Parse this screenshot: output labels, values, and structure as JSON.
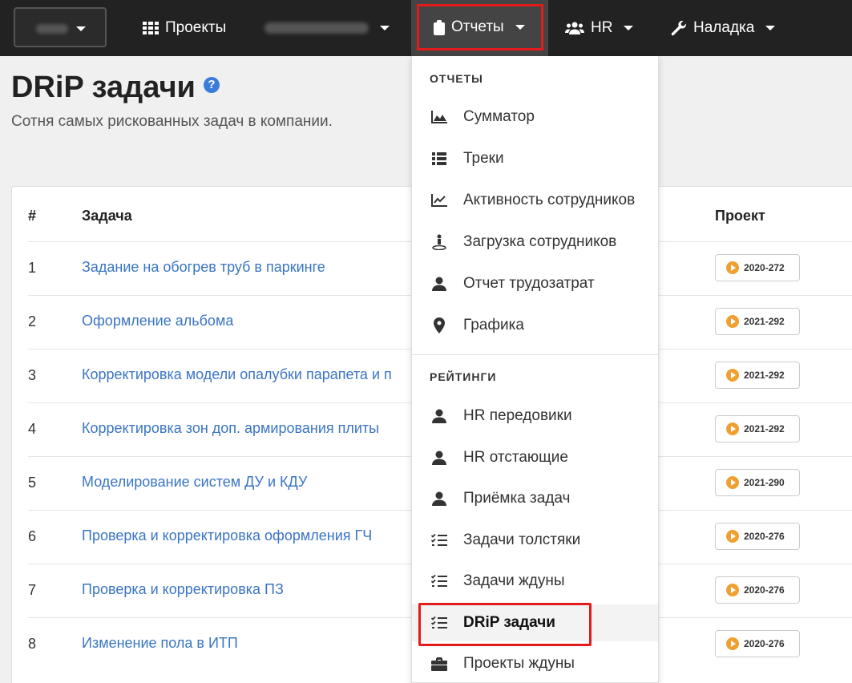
{
  "navbar": {
    "workspace_caret": "chevron-down-icon",
    "items": [
      {
        "label": "Проекты",
        "icon": "grid-icon"
      },
      {
        "label": "",
        "icon": ""
      },
      {
        "label": "Отчеты",
        "icon": "clipboard-icon"
      },
      {
        "label": "HR",
        "icon": "users-icon"
      },
      {
        "label": "Наладка",
        "icon": "wrench-icon"
      }
    ]
  },
  "page": {
    "title": "DRiP задачи",
    "help_icon": "question-circle-icon",
    "subtitle": "Сотня самых рискованных задач в компании."
  },
  "table": {
    "columns": [
      "#",
      "Задача",
      "Проект"
    ],
    "rows": [
      {
        "num": "1",
        "task": "Задание на обогрев труб в паркинге",
        "project": "2020-272"
      },
      {
        "num": "2",
        "task": "Оформление альбома",
        "project": "2021-292"
      },
      {
        "num": "3",
        "task": "Корректировка модели опалубки парапета и п",
        "project": "2021-292"
      },
      {
        "num": "4",
        "task": "Корректировка зон доп. армирования плиты",
        "project": "2021-292"
      },
      {
        "num": "5",
        "task": "Моделирование систем ДУ и КДУ",
        "project": "2021-290"
      },
      {
        "num": "6",
        "task": "Проверка и корректировка оформления ГЧ",
        "project": "2020-276"
      },
      {
        "num": "7",
        "task": "Проверка и корректировка ПЗ",
        "project": "2020-276"
      },
      {
        "num": "8",
        "task": "Изменение пола в ИТП",
        "project": "2020-276"
      }
    ]
  },
  "dropdown": {
    "reports_header": "ОТЧЕТЫ",
    "ratings_header": "РЕЙТИНГИ",
    "reports": [
      {
        "label": "Сумматор",
        "icon": "area-chart-icon"
      },
      {
        "label": "Треки",
        "icon": "list-icon"
      },
      {
        "label": "Активность сотрудников",
        "icon": "line-chart-icon"
      },
      {
        "label": "Загрузка сотрудников",
        "icon": "person-pin-icon"
      },
      {
        "label": "Отчет трудозатрат",
        "icon": "user-icon"
      },
      {
        "label": "Графика",
        "icon": "map-marker-icon"
      }
    ],
    "ratings": [
      {
        "label": "HR передовики",
        "icon": "user-icon"
      },
      {
        "label": "HR отстающие",
        "icon": "user-icon"
      },
      {
        "label": "Приёмка задач",
        "icon": "user-icon"
      },
      {
        "label": "Задачи толстяки",
        "icon": "tasks-icon"
      },
      {
        "label": "Задачи ждуны",
        "icon": "tasks-icon"
      },
      {
        "label": "DRiP задачи",
        "icon": "tasks-icon",
        "active": true
      },
      {
        "label": "Проекты ждуны",
        "icon": "briefcase-icon"
      }
    ]
  },
  "colors": {
    "navbar_bg": "#222222",
    "highlight_red": "#e31b1b",
    "link_blue": "#3a75c4",
    "badge_play": "#f0a030"
  }
}
